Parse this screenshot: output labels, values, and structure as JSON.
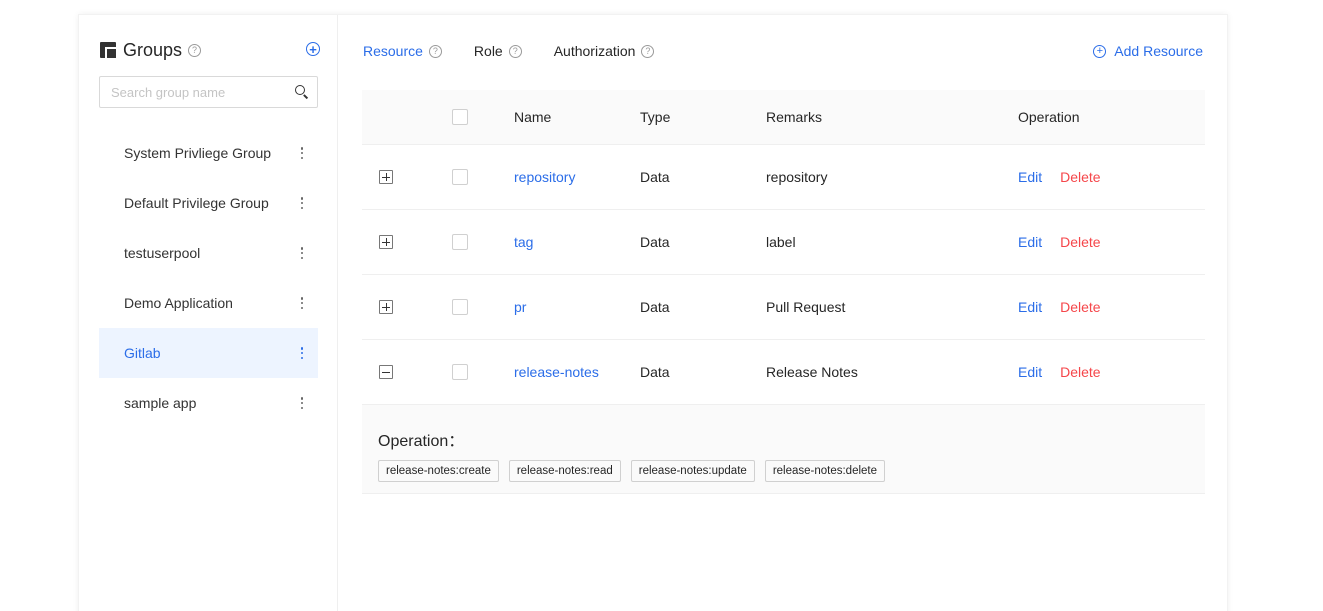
{
  "sidebar": {
    "title": "Groups",
    "search_placeholder": "Search group name",
    "items": [
      {
        "label": "System Privliege Group"
      },
      {
        "label": "Default Privilege Group"
      },
      {
        "label": "testuserpool"
      },
      {
        "label": "Demo Application"
      },
      {
        "label": "Gitlab",
        "active": true
      },
      {
        "label": "sample app"
      }
    ]
  },
  "tabs": [
    {
      "label": "Resource",
      "active": true
    },
    {
      "label": "Role"
    },
    {
      "label": "Authorization"
    }
  ],
  "add_resource_label": "Add Resource",
  "table": {
    "headers": {
      "name": "Name",
      "type": "Type",
      "remarks": "Remarks",
      "operation": "Operation"
    },
    "rows": [
      {
        "name": "repository",
        "type": "Data",
        "remarks": "repository",
        "edit": "Edit",
        "delete": "Delete",
        "expanded": false
      },
      {
        "name": "tag",
        "type": "Data",
        "remarks": "label",
        "edit": "Edit",
        "delete": "Delete",
        "expanded": false
      },
      {
        "name": "pr",
        "type": "Data",
        "remarks": "Pull Request",
        "edit": "Edit",
        "delete": "Delete",
        "expanded": false
      },
      {
        "name": "release-notes",
        "type": "Data",
        "remarks": "Release Notes",
        "edit": "Edit",
        "delete": "Delete",
        "expanded": true
      }
    ],
    "expanded_panel": {
      "title": "Operation：",
      "tags": [
        "release-notes:create",
        "release-notes:read",
        "release-notes:update",
        "release-notes:delete"
      ]
    }
  },
  "colors": {
    "accent": "#2b6de8",
    "danger": "#f5464a",
    "active_bg": "#edf4ff"
  },
  "icons": {
    "groups": "groups-icon",
    "help": "help-icon",
    "add": "add-circle-icon",
    "search": "search-icon",
    "more": "more-vertical-icon",
    "expand": "plus-square-icon",
    "collapse": "minus-square-icon"
  }
}
